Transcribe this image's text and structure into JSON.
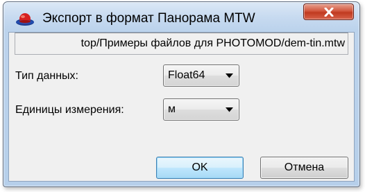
{
  "window": {
    "title": "Экспорт в формат Панорама MTW",
    "close_icon": "close-x-icon",
    "app_icon": "red-hat-icon"
  },
  "path_field": {
    "value": "top/Примеры файлов для PHOTOMOD/dem-tin.mtw"
  },
  "data_type": {
    "label": "Тип данных:",
    "selected": "Float64"
  },
  "units": {
    "label": "Единицы измерения:",
    "selected": "м"
  },
  "buttons": {
    "ok": "OK",
    "cancel": "Отмена"
  },
  "colors": {
    "close_button": "#c8452b",
    "default_button_border": "#3c7fb1",
    "frame": "#c7daf0"
  }
}
